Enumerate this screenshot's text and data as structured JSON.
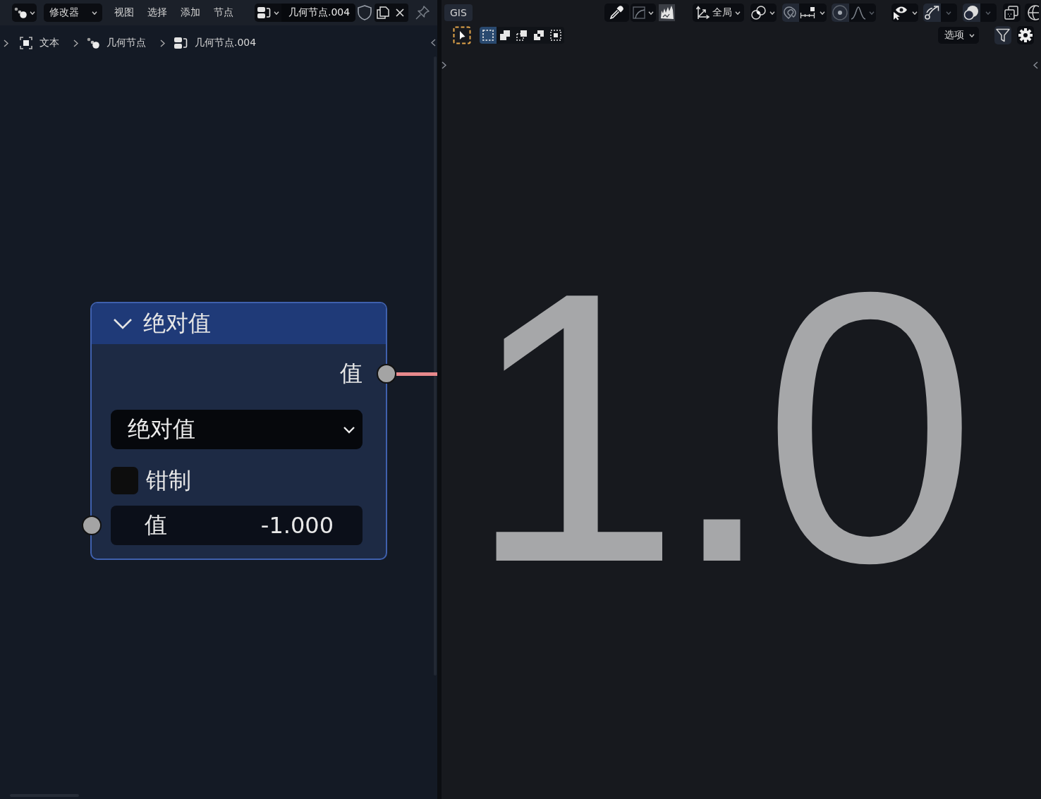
{
  "node_editor": {
    "header": {
      "mode": "修改器",
      "menus": [
        "视图",
        "选择",
        "添加",
        "节点"
      ],
      "node_tree": "几何节点.004"
    },
    "breadcrumbs": [
      {
        "kind": "object",
        "label": "文本"
      },
      {
        "kind": "modifier",
        "label": "几何节点"
      },
      {
        "kind": "node_group",
        "label": "几何节点.004"
      }
    ],
    "node": {
      "title": "绝对值",
      "expanded": true,
      "outputs": [
        {
          "label": "值",
          "linked": true
        }
      ],
      "operation": "绝对值",
      "clamp": {
        "label": "钳制",
        "checked": false
      },
      "inputs": [
        {
          "label": "值",
          "value": "-1.000"
        }
      ]
    }
  },
  "viewport": {
    "header": {
      "menu_button": "GIS",
      "orientation": "全局",
      "select_modes": [
        {
          "kind": "set",
          "selected": true
        },
        {
          "kind": "extend",
          "selected": false
        },
        {
          "kind": "subtract",
          "selected": false
        },
        {
          "kind": "difference",
          "selected": false
        },
        {
          "kind": "intersect",
          "selected": false
        }
      ],
      "options": "选项"
    },
    "text_object": "1.0"
  }
}
